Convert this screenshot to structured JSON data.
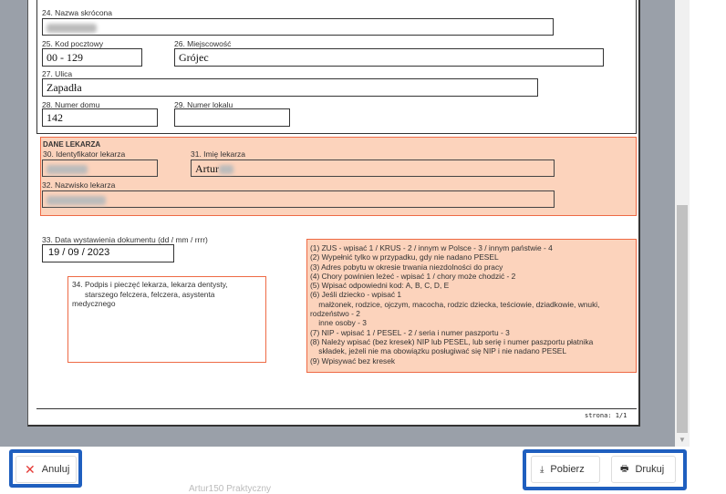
{
  "form": {
    "f24_label": "24. Nazwa skrócona",
    "f25_label": "25. Kod pocztowy",
    "f25_value": "00 - 129",
    "f26_label": "26. Miejscowość",
    "f26_value": "Grójec",
    "f27_label": "27. Ulica",
    "f27_value": "Zapadła",
    "f28_label": "28. Numer domu",
    "f28_value": "142",
    "f29_label": "29. Numer lokalu",
    "f29_value": "",
    "doctor_header": "DANE LEKARZA",
    "f30_label": "30. Identyfikator lekarza",
    "f31_label": "31. Imię lekarza",
    "f31_value": "Artur",
    "f32_label": "32. Nazwisko lekarza",
    "f33_label": "33. Data wystawienia dokumentu (dd / mm / rrrr)",
    "f33_value": "19 / 09 / 2023",
    "f34_lines": [
      "34. Podpis i pieczęć lekarza, lekarza dentysty,",
      "starszego felczera, felczera, asystenta",
      "medycznego"
    ],
    "notes": [
      "(1) ZUS - wpisać 1 / KRUS - 2 / innym w Polsce - 3 / innym państwie - 4",
      "(2) Wypełnić tylko w przypadku, gdy nie nadano PESEL",
      "(3) Adres pobytu w okresie trwania niezdolności do pracy",
      "(4) Chory powinien leżeć - wpisać 1 / chory może chodzić - 2",
      "(5) Wpisać odpowiedni kod: A, B, C, D, E",
      "(6) Jeśli dziecko - wpisać 1",
      "    małżonek, rodzice, ojczym, macocha, rodzic dziecka, teściowie, dziadkowie, wnuki,",
      "rodzeństwo - 2",
      "    inne osoby - 3",
      "(7) NIP - wpisać 1 / PESEL - 2 / seria i numer paszportu - 3",
      "(8) Należy wpisać (bez kresek) NIP lub PESEL, lub serię i numer paszportu płatnika",
      "    składek, jeżeli nie ma obowiązku posługiwać się NIP i nie nadano PESEL",
      "(9) Wpisywać bez kresek"
    ],
    "page_label": "strona: 1/1"
  },
  "footer": {
    "cancel": "Anuluj",
    "download": "Pobierz",
    "print": "Drukuj",
    "behind_text": "Artur150 Praktyczny"
  },
  "colors": {
    "highlight": "#1f5fbf",
    "pink": "#fcd3bc",
    "pink_border": "#ee6a45",
    "cancel_icon": "#e53935"
  }
}
